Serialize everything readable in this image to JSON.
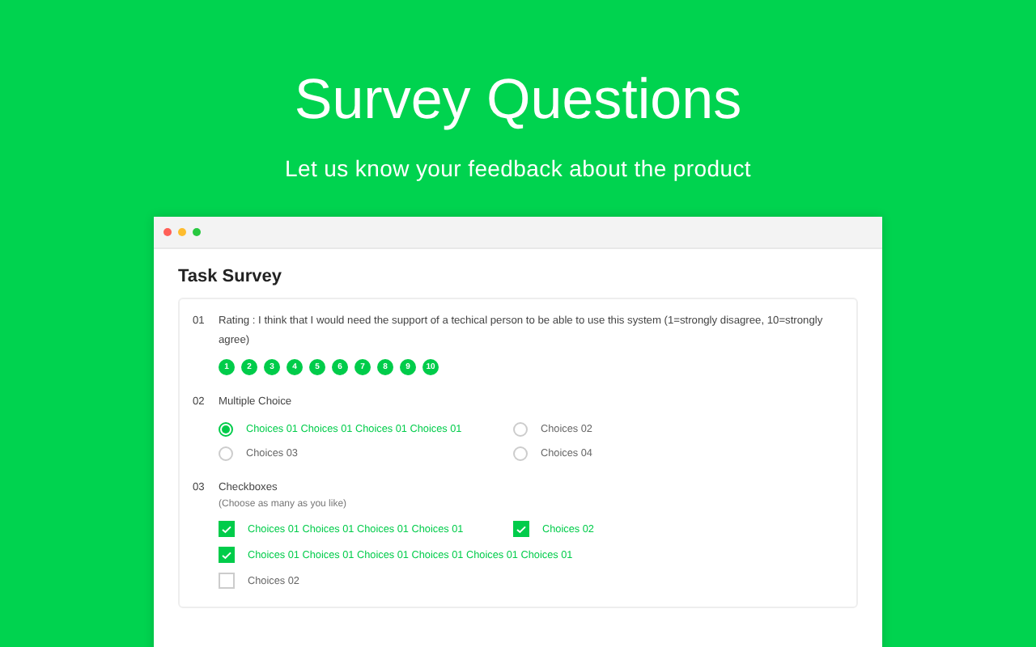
{
  "hero": {
    "title": "Survey Questions",
    "subtitle": "Let us know your feedback about the product"
  },
  "window": {
    "title": "Task Survey"
  },
  "questions": [
    {
      "kind": "rating",
      "number": "01",
      "text": "Rating : I think that I would need the support of a techical person to be able to use this system (1=strongly disagree, 10=strongly agree)",
      "scale": [
        "1",
        "2",
        "3",
        "4",
        "5",
        "6",
        "7",
        "8",
        "9",
        "10"
      ]
    },
    {
      "kind": "radio",
      "number": "02",
      "text": "Multiple Choice",
      "options": [
        {
          "label": "Choices 01 Choices 01 Choices 01 Choices 01",
          "selected": true
        },
        {
          "label": "Choices 02",
          "selected": false
        },
        {
          "label": "Choices 03",
          "selected": false
        },
        {
          "label": "Choices 04",
          "selected": false
        }
      ]
    },
    {
      "kind": "checkbox",
      "number": "03",
      "text": "Checkboxes",
      "hint": "(Choose as many as you like)",
      "options": [
        {
          "label": "Choices 01 Choices 01 Choices 01 Choices 01",
          "checked": true
        },
        {
          "label": "Choices 02",
          "checked": true
        },
        {
          "label": "Choices 01 Choices 01 Choices 01 Choices 01  Choices 01  Choices 01",
          "checked": true
        },
        {
          "label": "Choices 02",
          "checked": false
        }
      ]
    }
  ]
}
